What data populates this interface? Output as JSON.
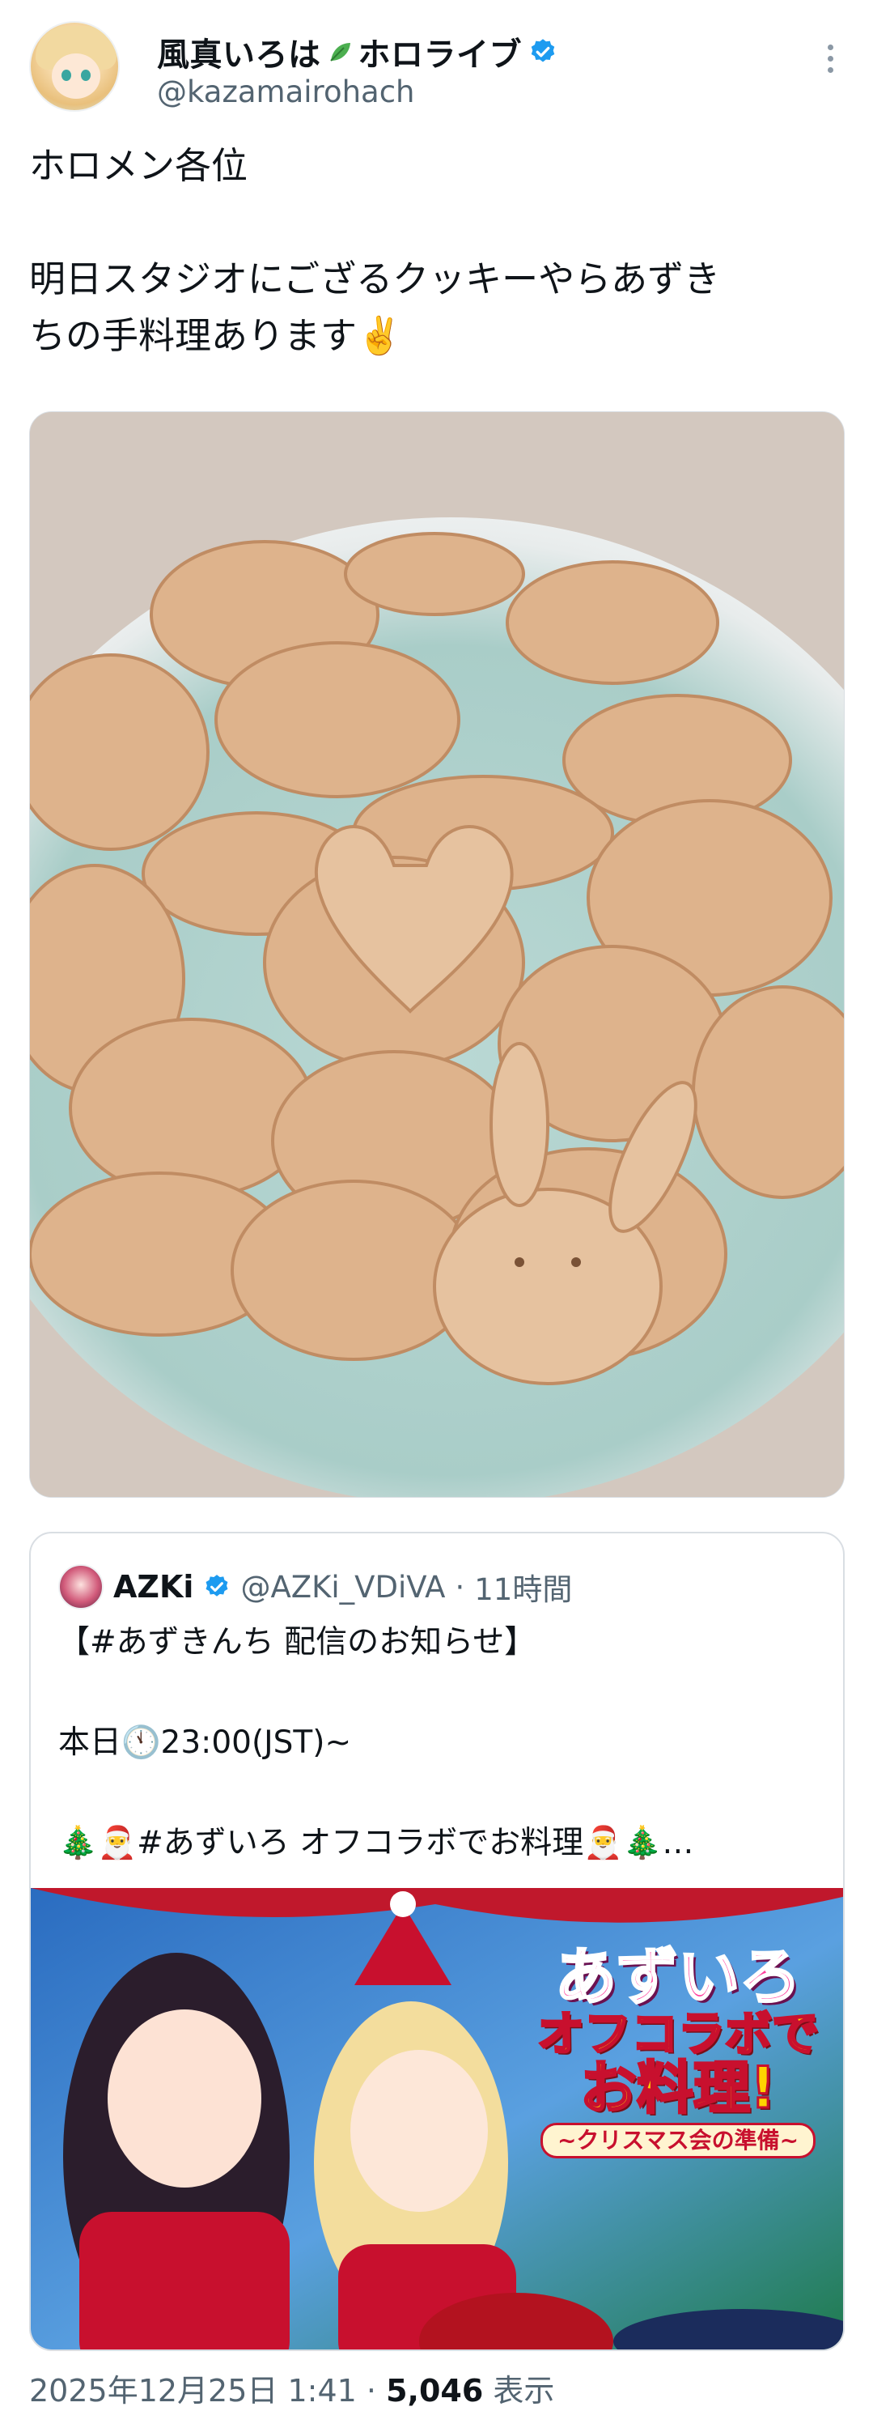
{
  "tweet": {
    "display_name": "風真いろは",
    "display_name_suffix": "ホロライブ",
    "handle": "@kazamairohach",
    "text": "ホロメン各位\n\n明日スタジオにござるクッキーやらあずき\nちの手料理あります✌️",
    "icons": {
      "leaf": "leaf-emoji-icon",
      "verified": "verified-badge-icon",
      "more": "more-options-icon"
    }
  },
  "photo": {
    "alt": "cookies-plate-photo"
  },
  "quote": {
    "name": "AZKi",
    "handle": "@AZKi_VDiVA",
    "separator": "·",
    "time": "11時間",
    "text": "【#あずきんち 配信のお知らせ】\n\n本日🕚23:00(JST)~\n\n🎄🎅#あずいろ オフコラボでお料理🎅🎄…",
    "banner": {
      "title_line1": "あずいろ",
      "title_line2": "オフコラボで",
      "title_line3": "お料理!",
      "subtitle": "~クリスマス会の準備~"
    }
  },
  "meta": {
    "timestamp": "2025年12月25日 1:41",
    "separator": " · ",
    "views_count": "5,046",
    "views_label": " 表示"
  },
  "colors": {
    "text_primary": "#0f1419",
    "text_secondary": "#536471",
    "verified_blue": "#1d9bf0",
    "border": "#d9dee3"
  }
}
